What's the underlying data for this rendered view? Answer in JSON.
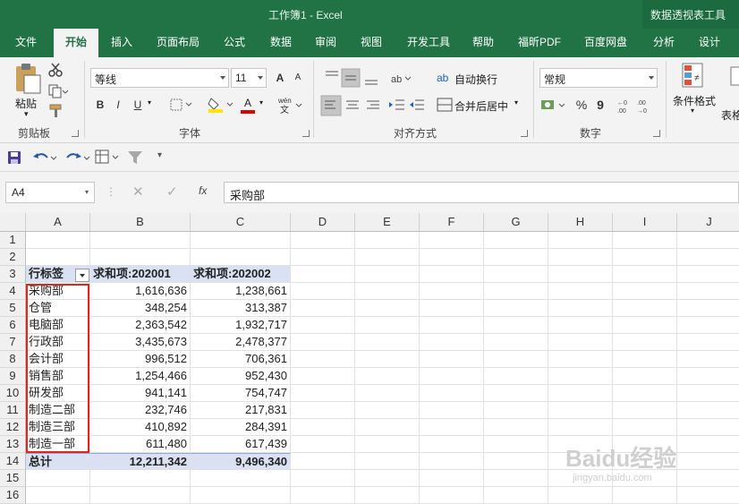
{
  "window": {
    "title": "工作簿1  -  Excel",
    "context_tool": "数据透视表工具"
  },
  "tabs": [
    "文件",
    "开始",
    "插入",
    "页面布局",
    "公式",
    "数据",
    "审阅",
    "视图",
    "开发工具",
    "帮助",
    "福昕PDF",
    "百度网盘",
    "分析",
    "设计"
  ],
  "ribbon": {
    "clipboard": {
      "paste_label": "粘贴",
      "group_label": "剪贴板"
    },
    "font": {
      "font_name": "等线",
      "font_size": "11",
      "bold": "B",
      "italic": "I",
      "underline": "U",
      "grow": "A",
      "shrink": "A",
      "font_color": "A",
      "group_label": "字体"
    },
    "alignment": {
      "wrap_text": "自动换行",
      "merge_center": "合并后居中",
      "group_label": "对齐方式"
    },
    "number": {
      "format": "常规",
      "percent": "%",
      "comma": "9",
      "group_label": "数字"
    },
    "styles": {
      "conditional_format": "条件格式",
      "table_format": "表格"
    }
  },
  "formula_bar": {
    "name_box": "A4",
    "fx": "fx",
    "content": "采购部"
  },
  "columns": [
    "A",
    "B",
    "C",
    "D",
    "E",
    "F",
    "G",
    "H",
    "I",
    "J"
  ],
  "rows": [
    "1",
    "2",
    "3",
    "4",
    "5",
    "6",
    "7",
    "8",
    "9",
    "10",
    "11",
    "12",
    "13",
    "14",
    "15",
    "16"
  ],
  "pivot": {
    "header": [
      "行标签",
      "求和项:202001",
      "求和项:202002"
    ],
    "data": [
      [
        "采购部",
        "1,616,636",
        "1,238,661"
      ],
      [
        "仓管",
        "348,254",
        "313,387"
      ],
      [
        "电脑部",
        "2,363,542",
        "1,932,717"
      ],
      [
        "行政部",
        "3,435,673",
        "2,478,377"
      ],
      [
        "会计部",
        "996,512",
        "706,361"
      ],
      [
        "销售部",
        "1,254,466",
        "952,430"
      ],
      [
        "研发部",
        "941,141",
        "754,747"
      ],
      [
        "制造二部",
        "232,746",
        "217,831"
      ],
      [
        "制造三部",
        "410,892",
        "284,391"
      ],
      [
        "制造一部",
        "611,480",
        "617,439"
      ]
    ],
    "total": [
      "总计",
      "12,211,342",
      "9,496,340"
    ]
  },
  "watermark": {
    "brand": "Baidu经验",
    "url": "jingyan.baidu.com"
  },
  "colors": {
    "excel_green": "#217346",
    "highlight_red": "#e1251b",
    "pivot_header_fill": "#d9e1f2"
  }
}
